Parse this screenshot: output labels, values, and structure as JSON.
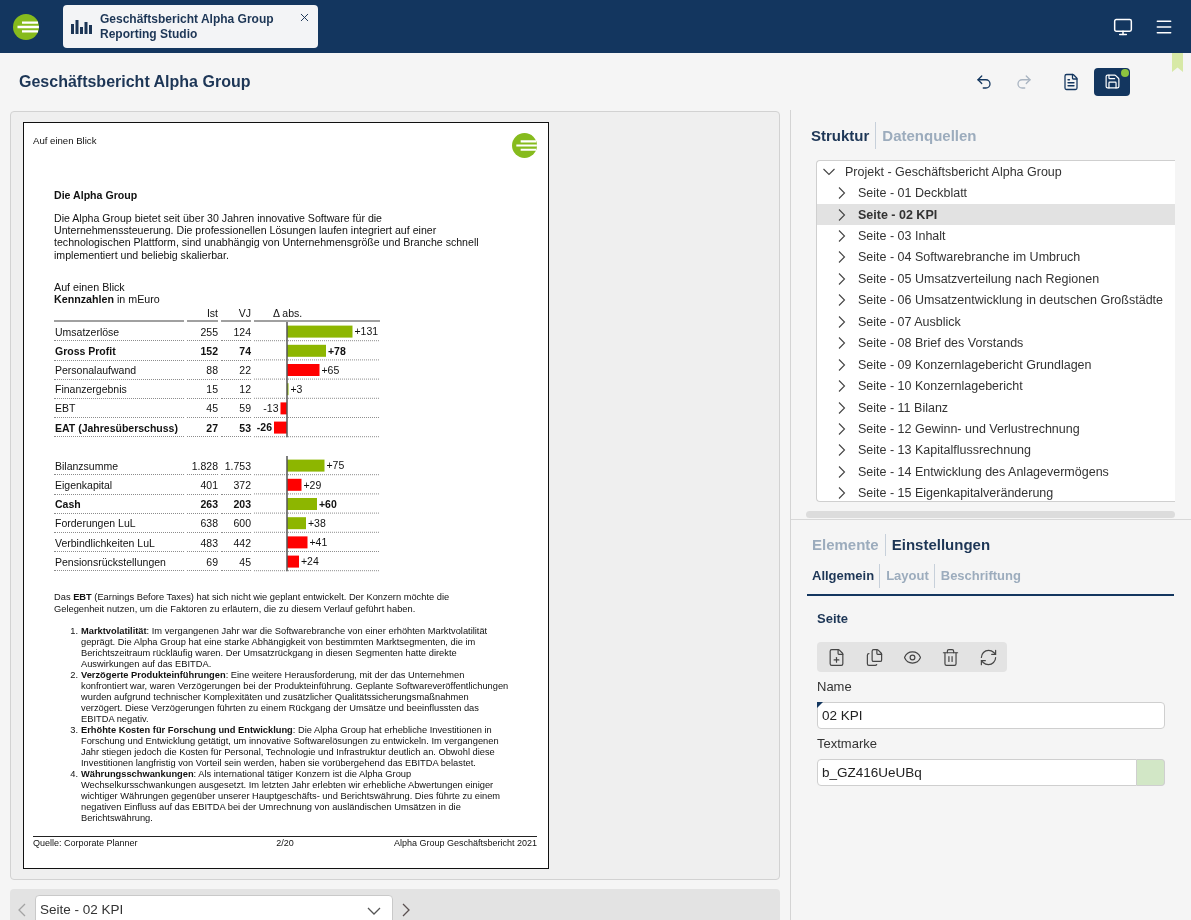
{
  "app_bar": {
    "document_tab": {
      "title": "Geschäftsbericht Alpha Group",
      "subtitle": "Reporting Studio",
      "selected": true
    }
  },
  "page_header": {
    "title": "Geschäftsbericht Alpha Group",
    "actions": [
      {
        "kind": "undo",
        "disabled": false,
        "badge": false
      },
      {
        "kind": "redo",
        "disabled": true,
        "badge": false
      },
      {
        "kind": "page",
        "disabled": false,
        "badge": false
      },
      {
        "kind": "save",
        "disabled": false,
        "badge": true
      }
    ]
  },
  "document": {
    "header": "Auf einen Blick",
    "heading": "Die Alpha Group",
    "intro": "Die Alpha Group bietet seit über 30 Jahren innovative Software für die Unternehmenssteuerung. Die professionellen Lösungen laufen integriert auf einer technologischen Plattform, sind unabhängig von Unternehmensgröße und Branche schnell implementiert und beliebig skalierbar.",
    "kpi": {
      "caption": "Auf einen Blick",
      "subtitle": "**Kennzahlen** in mEuro",
      "columns": [
        "Ist",
        "VJ",
        "Δ abs."
      ],
      "sections": [
        {
          "rows": [
            {
              "bold": false,
              "ist": "255",
              "vj": "124"
            },
            {
              "bold": true,
              "ist": "152",
              "vj": "74"
            },
            {
              "bold": false,
              "ist": "88",
              "vj": "22"
            },
            {
              "bold": false,
              "ist": "15",
              "vj": "12"
            },
            {
              "bold": false,
              "ist": "45",
              "vj": "59"
            },
            {
              "bold": true,
              "ist": "27",
              "vj": "53"
            }
          ],
          "chart_data": {
            "type": "bar",
            "orientation": "horizontal",
            "stacked": true,
            "categories": [
              "Umsatzerlöse",
              "Gross Profit",
              "Personalaufwand",
              "Finanzergebnis",
              "EBT",
              "EAT (Jahresüberschuss)"
            ],
            "series": [
              {
                "color": "#8db600",
                "values": [
                  131,
                  78,
                  null,
                  3,
                  null,
                  null
                ],
                "value_labels": [
                  "+131",
                  "+78",
                  null,
                  "+3",
                  null,
                  null
                ]
              },
              {
                "color": "#ff0000",
                "values": [
                  null,
                  null,
                  65,
                  null,
                  -13,
                  -26
                ],
                "value_labels": [
                  null,
                  null,
                  "+65",
                  null,
                  "-13",
                  "-26"
                ]
              }
            ]
          }
        },
        {
          "rows": [
            {
              "bold": false,
              "ist": "1.828",
              "vj": "1.753"
            },
            {
              "bold": false,
              "ist": "401",
              "vj": "372"
            },
            {
              "bold": true,
              "ist": "263",
              "vj": "203"
            },
            {
              "bold": false,
              "ist": "638",
              "vj": "600"
            },
            {
              "bold": false,
              "ist": "483",
              "vj": "442"
            },
            {
              "bold": false,
              "ist": "69",
              "vj": "45"
            }
          ],
          "chart_data": {
            "type": "bar",
            "orientation": "horizontal",
            "stacked": true,
            "categories": [
              "Bilanzsumme",
              "Eigenkapital",
              "Cash",
              "Forderungen LuL",
              "Verbindlichkeiten LuL",
              "Pensionsrückstellungen"
            ],
            "series": [
              {
                "color": "#8db600",
                "values": [
                  75,
                  null,
                  60,
                  38,
                  null,
                  null
                ],
                "value_labels": [
                  "+75",
                  null,
                  "+60",
                  "+38",
                  null,
                  null
                ]
              },
              {
                "color": "#ff0000",
                "values": [
                  null,
                  29,
                  null,
                  null,
                  41,
                  24
                ],
                "value_labels": [
                  null,
                  "+29",
                  null,
                  null,
                  "+41",
                  "+24"
                ]
              }
            ]
          }
        }
      ]
    },
    "note": "Das **EBT** (Earnings Before Taxes) hat sich nicht wie geplant entwickelt. Der Konzern möchte die Gelegenheit nutzen, um die Faktoren zu erläutern, die zu diesem Verlauf geführt haben.",
    "factors": [
      {
        "number": "1.",
        "text": "**Marktvolatilität**: Im vergangenen Jahr war die Softwarebranche von einer erhöhten Marktvolatilität geprägt. Die Alpha Group hat eine starke Abhängigkeit von bestimmten Marktsegmenten, die im Berichtszeitraum rückläufig waren. Der Umsatzrückgang in diesen Segmenten hatte direkte Auswirkungen auf das EBITDA."
      },
      {
        "number": "2.",
        "text": "**Verzögerte Produkteinführungen**: Eine weitere Herausforderung, mit der das Unternehmen konfrontiert war, waren Verzögerungen bei der Produkteinführung. Geplante Softwareveröffentlichungen wurden aufgrund technischer Komplexitäten und zusätzlicher Qualitätssicherungsmaßnahmen verzögert. Diese Verzögerungen führten zu einem Rückgang der Umsätze und beeinflussten das EBITDA negativ."
      },
      {
        "number": "3.",
        "text": "**Erhöhte Kosten für Forschung und Entwicklung**: Die Alpha Group hat erhebliche Investitionen in Forschung und Entwicklung getätigt, um innovative Softwarelösungen zu entwickeln. Im vergangenen Jahr stiegen jedoch die Kosten für Personal, Technologie und Infrastruktur deutlich an. Obwohl diese Investitionen langfristig von Vorteil sein werden, haben sie vorübergehend das EBITDA belastet."
      },
      {
        "number": "4.",
        "text": "**Währungsschwankungen**: Als international tätiger Konzern ist die Alpha Group Wechselkursschwankungen ausgesetzt. Im letzten Jahr erlebten wir erhebliche Abwertungen einiger wichtiger Währungen gegenüber unserer Hauptgeschäfts- und Berichtswährung. Dies führte zu einem negativen Einfluss auf das EBITDA bei der Umrechnung von ausländischen Umsätzen in die Berichtswährung."
      }
    ],
    "footer": {
      "source": "Quelle: Corporate Planner",
      "page": "2/20",
      "title": "Alpha Group Geschäftsbericht 2021"
    }
  },
  "page_navigation": {
    "previous_disabled": true,
    "next_disabled": false,
    "page_select": {
      "value": "Seite - 02 KPI"
    }
  },
  "structure_panel": {
    "tabs": [
      {
        "label": "Struktur",
        "selected": true
      },
      {
        "label": "Datenquellen",
        "selected": false
      }
    ],
    "tree": {
      "label": "Projekt - Geschäftsbericht Alpha Group",
      "expanded": true,
      "selected": false,
      "children": [
        {
          "label": "Seite - 01 Deckblatt",
          "expanded": false,
          "selected": false
        },
        {
          "label": "Seite - 02 KPI",
          "expanded": false,
          "selected": true
        },
        {
          "label": "Seite - 03 Inhalt",
          "expanded": false,
          "selected": false
        },
        {
          "label": "Seite - 04 Softwarebranche im Umbruch",
          "expanded": false,
          "selected": false
        },
        {
          "label": "Seite - 05 Umsatzverteilung nach Regionen",
          "expanded": false,
          "selected": false
        },
        {
          "label": "Seite - 06 Umsatzentwicklung in deutschen Großstädte",
          "expanded": false,
          "selected": false
        },
        {
          "label": "Seite - 07 Ausblick",
          "expanded": false,
          "selected": false
        },
        {
          "label": "Seite - 08 Brief des Vorstands",
          "expanded": false,
          "selected": false
        },
        {
          "label": "Seite - 09 Konzernlagebericht Grundlagen",
          "expanded": false,
          "selected": false
        },
        {
          "label": "Seite - 10 Konzernlagebericht",
          "expanded": false,
          "selected": false
        },
        {
          "label": "Seite - 11 Bilanz",
          "expanded": false,
          "selected": false
        },
        {
          "label": "Seite - 12 Gewinn- und Verlustrechnung",
          "expanded": false,
          "selected": false
        },
        {
          "label": "Seite - 13 Kapitalflussrechnung",
          "expanded": false,
          "selected": false
        },
        {
          "label": "Seite - 14 Entwicklung des Anlagevermögens",
          "expanded": false,
          "selected": false
        },
        {
          "label": "Seite - 15 Eigenkapitalveränderung",
          "expanded": false,
          "selected": false
        }
      ]
    }
  },
  "settings_panel": {
    "tabs": [
      {
        "label": "Elemente",
        "selected": false
      },
      {
        "label": "Einstellungen",
        "selected": true
      }
    ],
    "subtabs": [
      {
        "label": "Allgemein",
        "selected": true
      },
      {
        "label": "Layout",
        "selected": false
      },
      {
        "label": "Beschriftung",
        "selected": false
      }
    ],
    "section_title": "Seite",
    "fields": [
      {
        "kind": "text",
        "label": "Name",
        "value": "02 KPI",
        "marked": true
      },
      {
        "kind": "swatch",
        "label": "Textmarke",
        "value": "b_GZ416UeUBq",
        "marked": false
      }
    ]
  }
}
